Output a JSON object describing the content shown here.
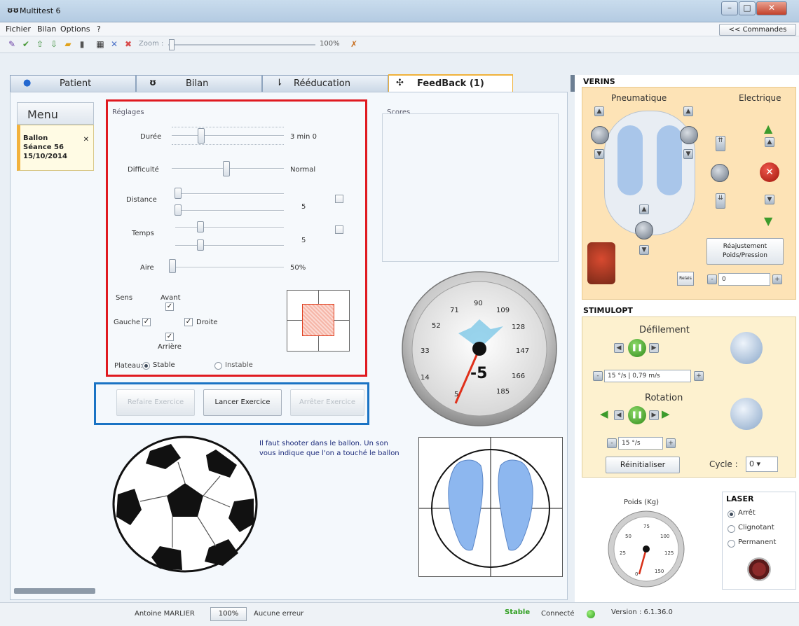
{
  "window": {
    "title": "Multitest 6",
    "minimize": "–",
    "maximize": "□",
    "close": "✕"
  },
  "menu": {
    "items": [
      "Fichier",
      "Bilan",
      "Options",
      "?"
    ],
    "commands_button": "<< Commandes"
  },
  "toolbar": {
    "zoom_label": "Zoom :",
    "zoom_value": "100%"
  },
  "tabs": [
    {
      "label": "Patient",
      "icon": "person-icon"
    },
    {
      "label": "Bilan",
      "icon": "feet-icon"
    },
    {
      "label": "Rééducation",
      "icon": "rehab-icon"
    },
    {
      "label": "FeedBack (1)",
      "icon": "target-icon",
      "active": true
    }
  ],
  "sidebar": {
    "menu_label": "Menu",
    "session": {
      "line1": "Ballon",
      "line2": "Séance 56",
      "line3": "15/10/2014"
    }
  },
  "settings": {
    "title": "Réglages",
    "duree": {
      "label": "Durée",
      "value": "3 min 0"
    },
    "difficulte": {
      "label": "Difficulté",
      "value": "Normal"
    },
    "distance": {
      "label": "Distance",
      "value": "5"
    },
    "temps": {
      "label": "Temps",
      "value": "5"
    },
    "aire": {
      "label": "Aire",
      "value": "50%"
    },
    "sens_label": "Sens",
    "avant": "Avant",
    "gauche": "Gauche",
    "droite": "Droite",
    "arriere": "Arrière",
    "plateau_label": "Plateau:",
    "stable": "Stable",
    "instable": "Instable"
  },
  "actions": {
    "reset": "Refaire Exercice",
    "start": "Lancer Exercice",
    "stop": "Arrêter Exercice"
  },
  "scores": {
    "title": "Scores"
  },
  "gauge": {
    "value": "-5",
    "ticks": [
      "14",
      "33",
      "52",
      "71",
      "90",
      "109",
      "128",
      "147",
      "166",
      "185",
      "5"
    ]
  },
  "info_text": "Il faut shooter dans le ballon. Un son vous indique que l'on a touché le ballon",
  "right": {
    "verins": {
      "title": "VERINS",
      "pneumatique": "Pneumatique",
      "electrique": "Electrique",
      "reajust": "Réajustement",
      "reajust2": "Poids/Pression",
      "small_btn": "Relais",
      "value": "0"
    },
    "stimulopt": {
      "title": "STIMULOPT",
      "defilement": "Défilement",
      "speed": "15 °/s | 0,79 m/s",
      "rotation": "Rotation",
      "rot_speed": "15 °/s",
      "reinit": "Réinitialiser",
      "cycle_label": "Cycle :",
      "cycle_value": "0"
    },
    "poids": {
      "title": "Poids (Kg)",
      "ticks": [
        "25",
        "50",
        "75",
        "100",
        "125",
        "150",
        "0"
      ]
    },
    "laser": {
      "title": "LASER",
      "arret": "Arrêt",
      "clignotant": "Clignotant",
      "permanent": "Permanent"
    }
  },
  "status": {
    "user": "Antoine MARLIER",
    "zoom": "100%",
    "errors": "Aucune erreur",
    "stable": "Stable",
    "connected": "Connecté",
    "version": "Version : 6.1.36.0"
  },
  "colors": {
    "red_frame": "#e01a20",
    "blue_frame": "#1a73c4",
    "tab_accent": "#f0b23a",
    "status_green": "#2e9e1f"
  }
}
